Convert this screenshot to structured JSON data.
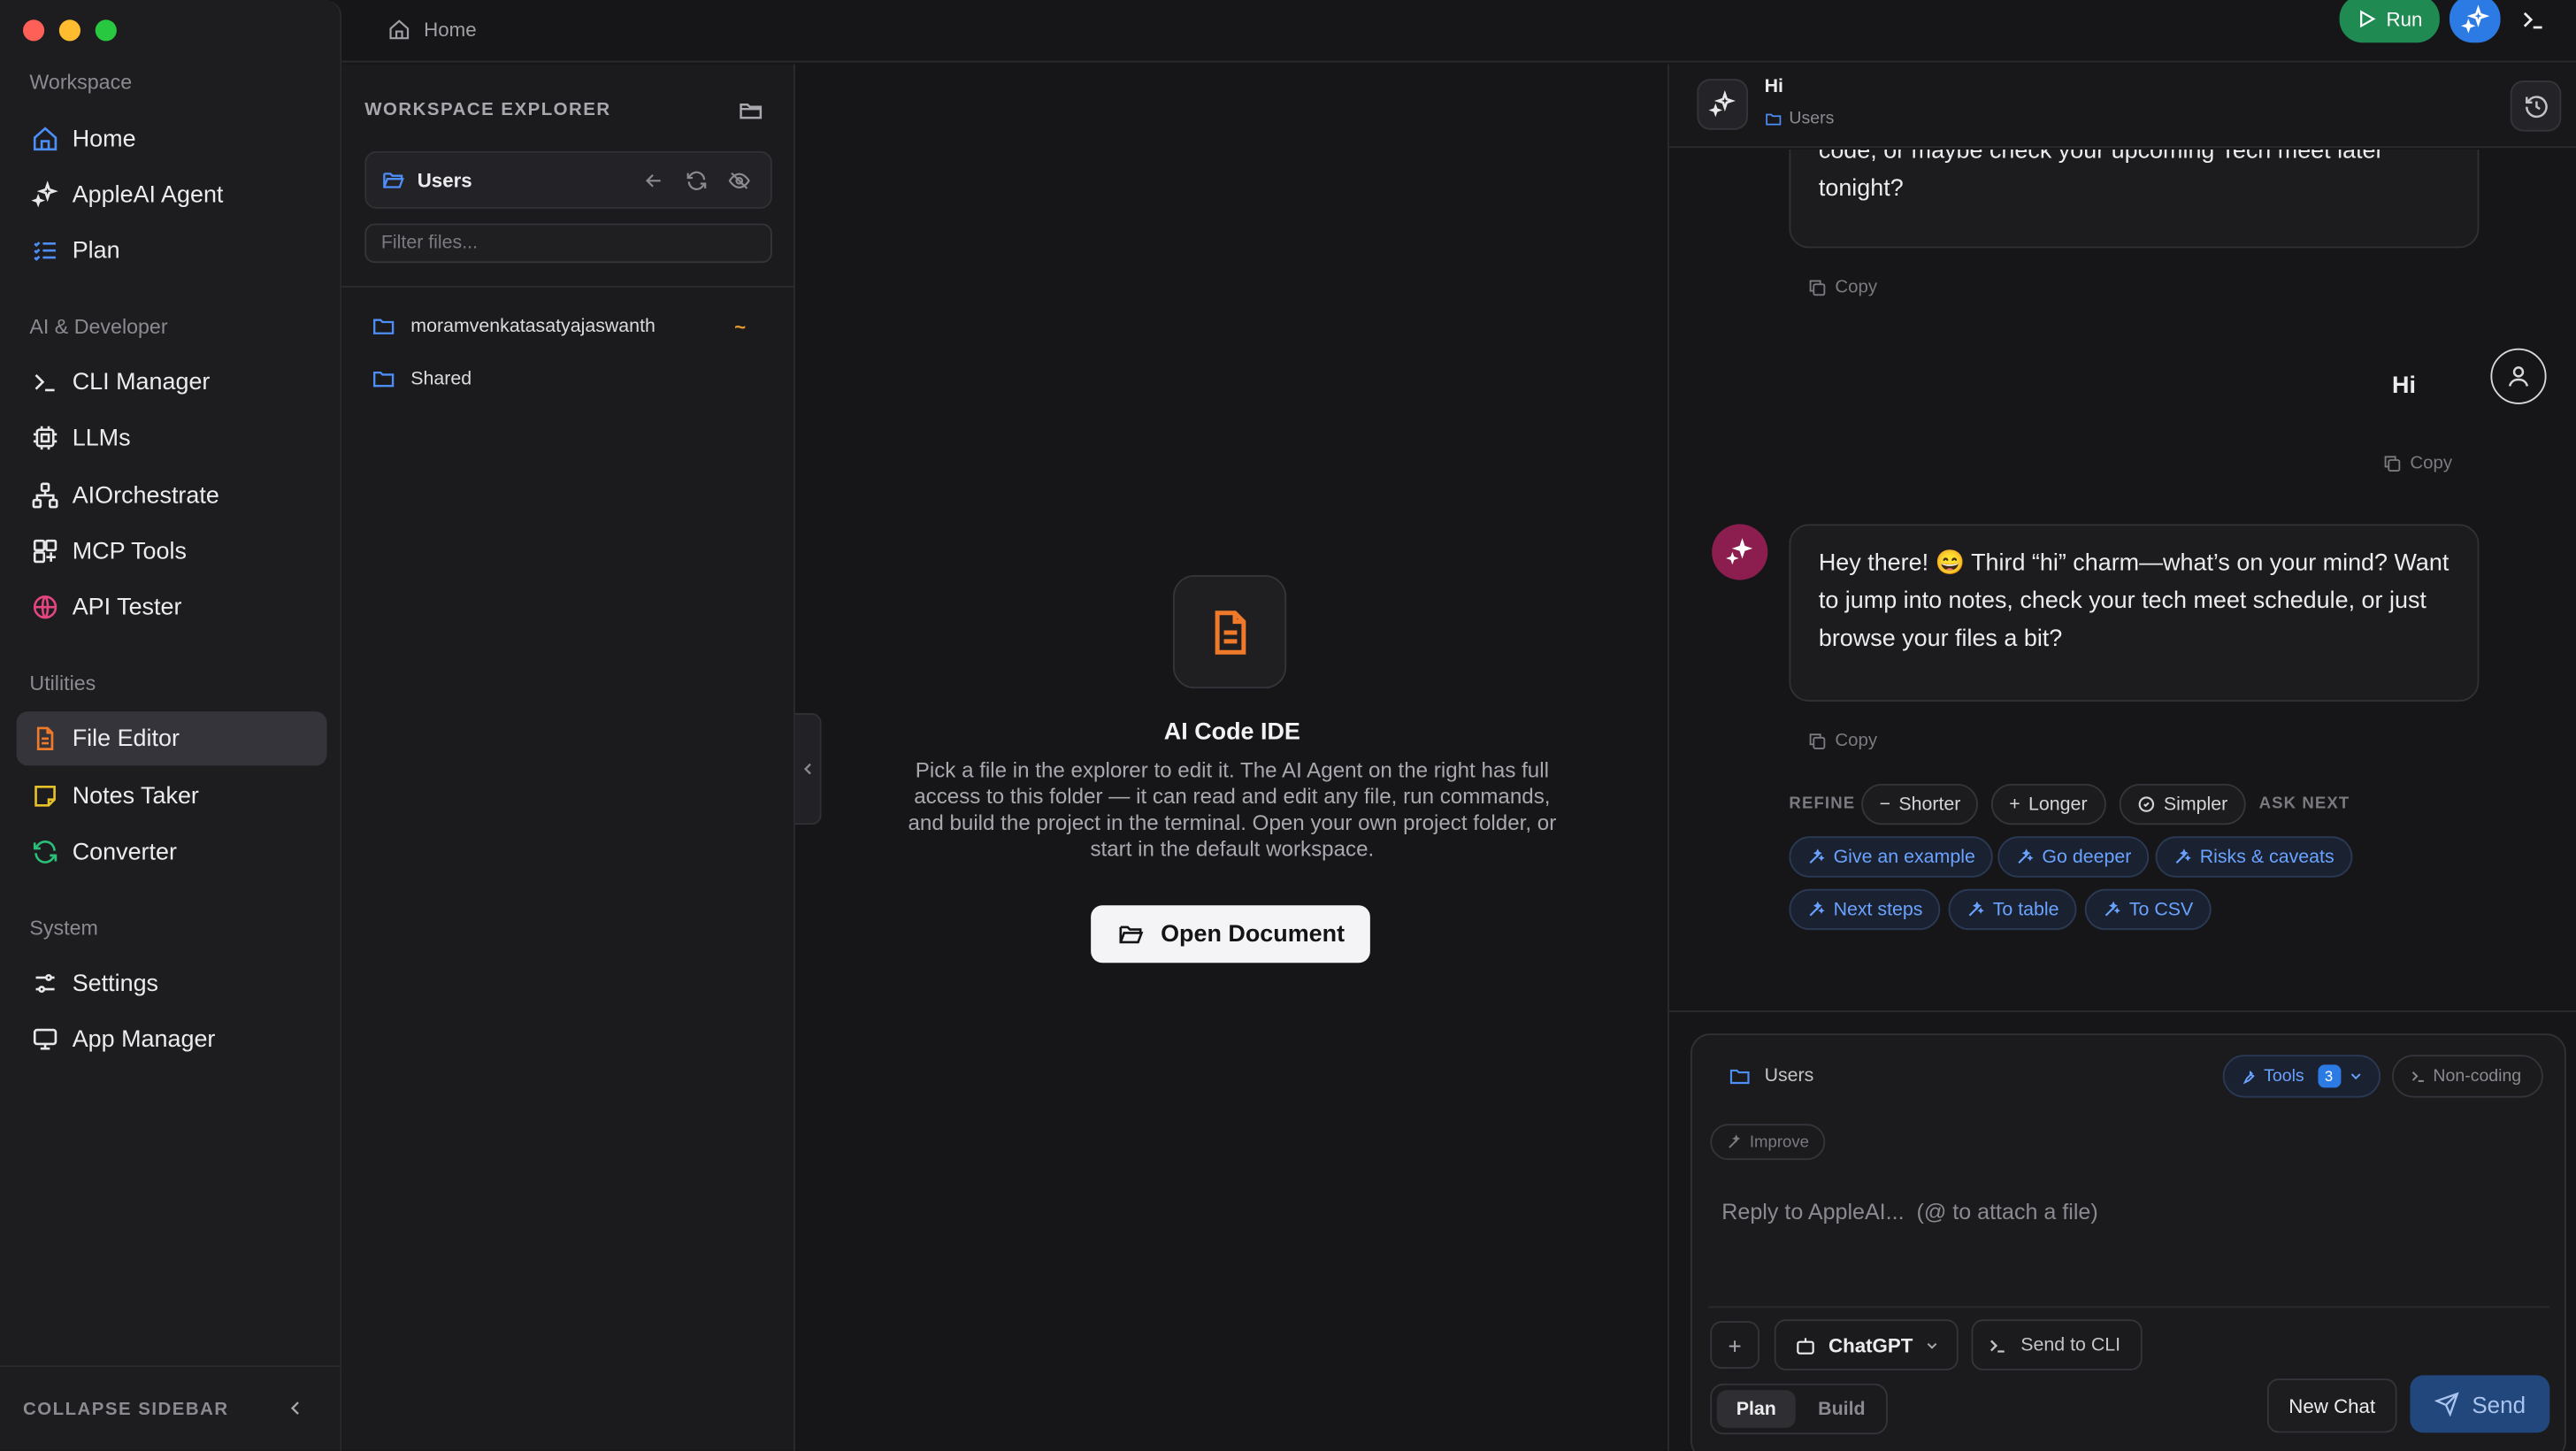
{
  "sidebar": {
    "sections": [
      {
        "title": "Workspace",
        "items": [
          {
            "label": "Home",
            "icon": "home-icon"
          },
          {
            "label": "AppleAI Agent",
            "icon": "sparkles-icon"
          },
          {
            "label": "Plan",
            "icon": "list-checks-icon"
          }
        ]
      },
      {
        "title": "AI & Developer",
        "items": [
          {
            "label": "CLI Manager",
            "icon": "terminal-icon"
          },
          {
            "label": "LLMs",
            "icon": "cpu-icon"
          },
          {
            "label": "AIOrchestrate",
            "icon": "network-icon"
          },
          {
            "label": "MCP Tools",
            "icon": "blocks-icon"
          },
          {
            "label": "API Tester",
            "icon": "globe-icon"
          }
        ]
      },
      {
        "title": "Utilities",
        "items": [
          {
            "label": "File Editor",
            "icon": "file-text-icon"
          },
          {
            "label": "Notes Taker",
            "icon": "sticky-note-icon"
          },
          {
            "label": "Converter",
            "icon": "refresh-icon"
          }
        ]
      },
      {
        "title": "System",
        "items": [
          {
            "label": "Settings",
            "icon": "sliders-icon"
          },
          {
            "label": "App Manager",
            "icon": "monitor-icon"
          }
        ]
      }
    ],
    "collapse_label": "COLLAPSE SIDEBAR"
  },
  "topbar": {
    "breadcrumb": "Home",
    "run_label": "Run"
  },
  "explorer": {
    "title": "WORKSPACE EXPLORER",
    "current_path": "Users",
    "filter_placeholder": "Filter files...",
    "items": [
      {
        "name": "moramvenkatasatyajaswanth",
        "modified": "~"
      },
      {
        "name": "Shared",
        "modified": ""
      }
    ]
  },
  "editor": {
    "title": "AI Code IDE",
    "description": "Pick a file in the explorer to edit it. The AI Agent on the right has full access to this folder — it can read and edit any file, run commands, and build the project in the terminal. Open your own project folder, or start in the default workspace.",
    "open_label": "Open Document"
  },
  "chat": {
    "title": "Hi",
    "folder": "Users",
    "prev_bot_text": "code, or maybe check your upcoming Tech meet later tonight?",
    "copy_label": "Copy",
    "user_text": "Hi",
    "bot_text": "Hey there! 😄 Third “hi” charm—what’s on your mind? Want to jump into notes, check your tech meet schedule, or just browse your files a bit?",
    "refine_label": "REFINE",
    "ask_next_label": "ASK NEXT",
    "refine_actions": [
      "Shorter",
      "Longer",
      "Simpler"
    ],
    "ask_next": [
      "Give an example",
      "Go deeper",
      "Risks & caveats",
      "Next steps",
      "To table",
      "To CSV"
    ]
  },
  "composer": {
    "folder": "Users",
    "tools_label": "Tools",
    "tools_count": "3",
    "mode_label": "Non-coding",
    "improve_label": "Improve",
    "placeholder": "Reply to AppleAI...  (@ to attach a file)",
    "model": "ChatGPT",
    "send_cli_label": "Send to CLI",
    "plan_label": "Plan",
    "build_label": "Build",
    "new_chat_label": "New Chat",
    "send_label": "Send"
  },
  "colors": {
    "accent_blue": "#2c7be5",
    "run_green": "#1f8a52",
    "file_orange": "#f07a2a"
  }
}
